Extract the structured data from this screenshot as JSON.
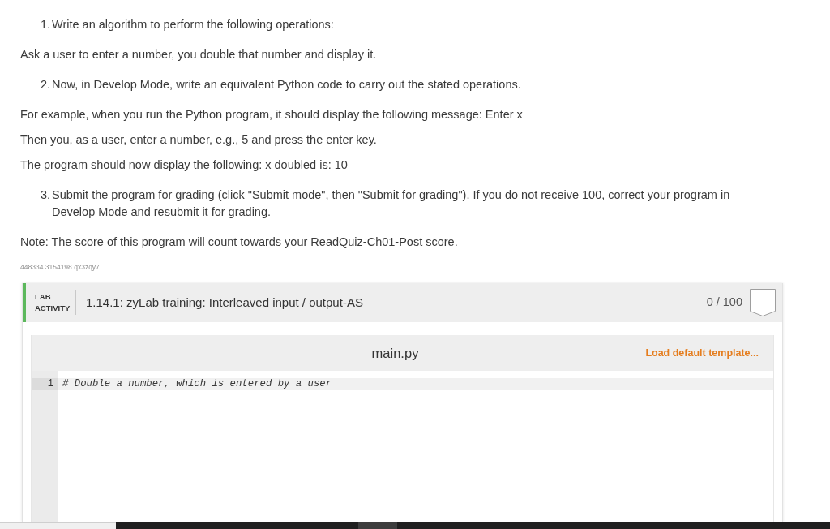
{
  "instructions": [
    {
      "kind": "numbered",
      "number": "1.",
      "text": "Write an algorithm to perform the following operations:"
    },
    {
      "kind": "paragraph",
      "lines": [
        "Ask a user to enter a number, you double that number and display it."
      ]
    },
    {
      "kind": "numbered",
      "number": "2.",
      "text": "Now, in Develop Mode, write an equivalent Python code to carry out the stated operations."
    },
    {
      "kind": "paragraph",
      "lines": [
        "For example, when you run the Python program, it should display the following message: Enter x",
        "Then you, as a user, enter a number, e.g., 5 and press the enter key.",
        "The program should now display the following: x doubled is: 10"
      ]
    },
    {
      "kind": "numbered",
      "number": "3.",
      "text": "Submit the program for grading (click \"Submit mode\", then \"Submit for grading\"). If you do not receive 100, correct your program in Develop Mode and resubmit it for grading."
    },
    {
      "kind": "paragraph",
      "lines": [
        "Note: The score of this program will count towards your ReadQuiz-Ch01-Post score."
      ]
    }
  ],
  "content_id": "448334.3154198.qx3zqy7",
  "lab": {
    "label": "LAB ACTIVITY",
    "title": "1.14.1: zyLab training: Interleaved input / output-AS",
    "score": "0 / 100",
    "completed": false,
    "editor": {
      "filename": "main.py",
      "action": "Load default template...",
      "lines": [
        {
          "number": "1",
          "code": "# Double a number, which is entered by a user",
          "active": true
        }
      ]
    }
  }
}
